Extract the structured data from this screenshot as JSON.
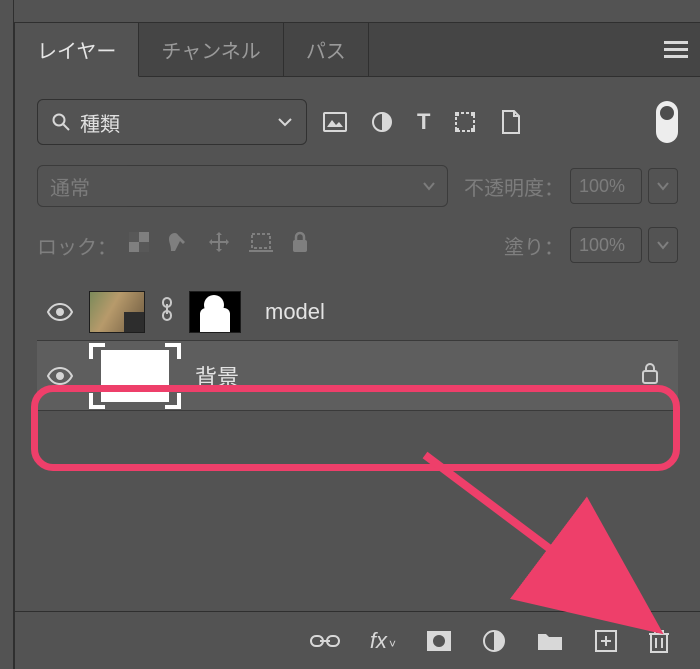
{
  "tabs": {
    "layers": "レイヤー",
    "channels": "チャンネル",
    "paths": "パス"
  },
  "search": {
    "label": "種類"
  },
  "blend": {
    "mode": "通常",
    "opacity_label": "不透明度：",
    "opacity_value": "100%"
  },
  "lock": {
    "label": "ロック：",
    "fill_label": "塗り：",
    "fill_value": "100%"
  },
  "layers": [
    {
      "name": "model"
    },
    {
      "name": "背景"
    }
  ],
  "annotation": {
    "color": "#ee3f6a"
  }
}
